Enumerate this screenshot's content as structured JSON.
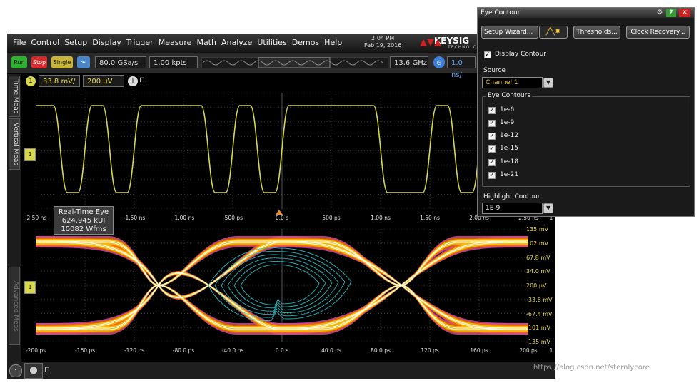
{
  "menu": [
    "File",
    "Control",
    "Setup",
    "Display",
    "Trigger",
    "Measure",
    "Math",
    "Analyze",
    "Utilities",
    "Demos",
    "Help"
  ],
  "datetime": {
    "time": "2:04 PM",
    "date": "Feb 19, 2016"
  },
  "brand": {
    "name": "KEYSIG",
    "sub": "TECHNOLOG"
  },
  "toolbar": {
    "run": "Run",
    "stop": "Stop",
    "single": "Single",
    "sample_rate": "80.0 GSa/s",
    "memory": "1.00 kpts",
    "bandwidth": "13.6 GHz",
    "timebase": "1.0 ns/"
  },
  "sidebar": {
    "tab1": "Time Meas",
    "tab2": "Vertical Meas",
    "tab3": "Advanced Meas"
  },
  "channel": {
    "number": "1",
    "scale": "33.8 mV/",
    "offset": "200 µV"
  },
  "top_time_ticks": [
    "-2.50 ns",
    "-2.00 ns",
    "-1.50 ns",
    "-1.00 ns",
    "-500 ps",
    "0.0 s",
    "500 ps",
    "1.00 ns",
    "1.50 ns",
    "2.00 ns",
    "2.50 ns"
  ],
  "top_time_end": "1",
  "eye_time_ticks": [
    "-200 ps",
    "-160 ps",
    "-120 ps",
    "-80.0 ps",
    "-40.0 ps",
    "0.0 s",
    "40.0 ps",
    "80.0 ps",
    "120 ps",
    "160 ps",
    "200 ps"
  ],
  "eye_time_end": "1",
  "eye_y_ticks": [
    "135 mV",
    "102 mV",
    "67.8 mV",
    "34.0 mV",
    "200 µV",
    "-33.6 mV",
    "-67.4 mV",
    "-101 mV",
    "-135 mV"
  ],
  "eye_info": {
    "title": "Real-Time Eye",
    "ui": "624.945 kUI",
    "wfms": "10082 Wfms"
  },
  "panel": {
    "title": "Eye Contour",
    "setup_wizard": "Setup Wizard...",
    "thresholds": "Thresholds...",
    "clock_recovery": "Clock Recovery...",
    "display_contour": "Display Contour",
    "source_label": "Source",
    "source_value": "Channel 1",
    "contours_label": "Eye Contours",
    "contours": [
      "1e-6",
      "1e-9",
      "1e-12",
      "1e-15",
      "1e-18",
      "1e-21"
    ],
    "highlight_label": "Highlight Contour",
    "highlight_value": "1E-9"
  },
  "watermark": "https://blog.csdn.net/sternlycore",
  "colors": {
    "trace": "#d8d84a",
    "eye_core": "#ffffff",
    "eye_mid": "#f5c000",
    "eye_edge": "#ff6a00",
    "eye_outer": "#d04aa8",
    "contour": "#2ec8d0"
  }
}
